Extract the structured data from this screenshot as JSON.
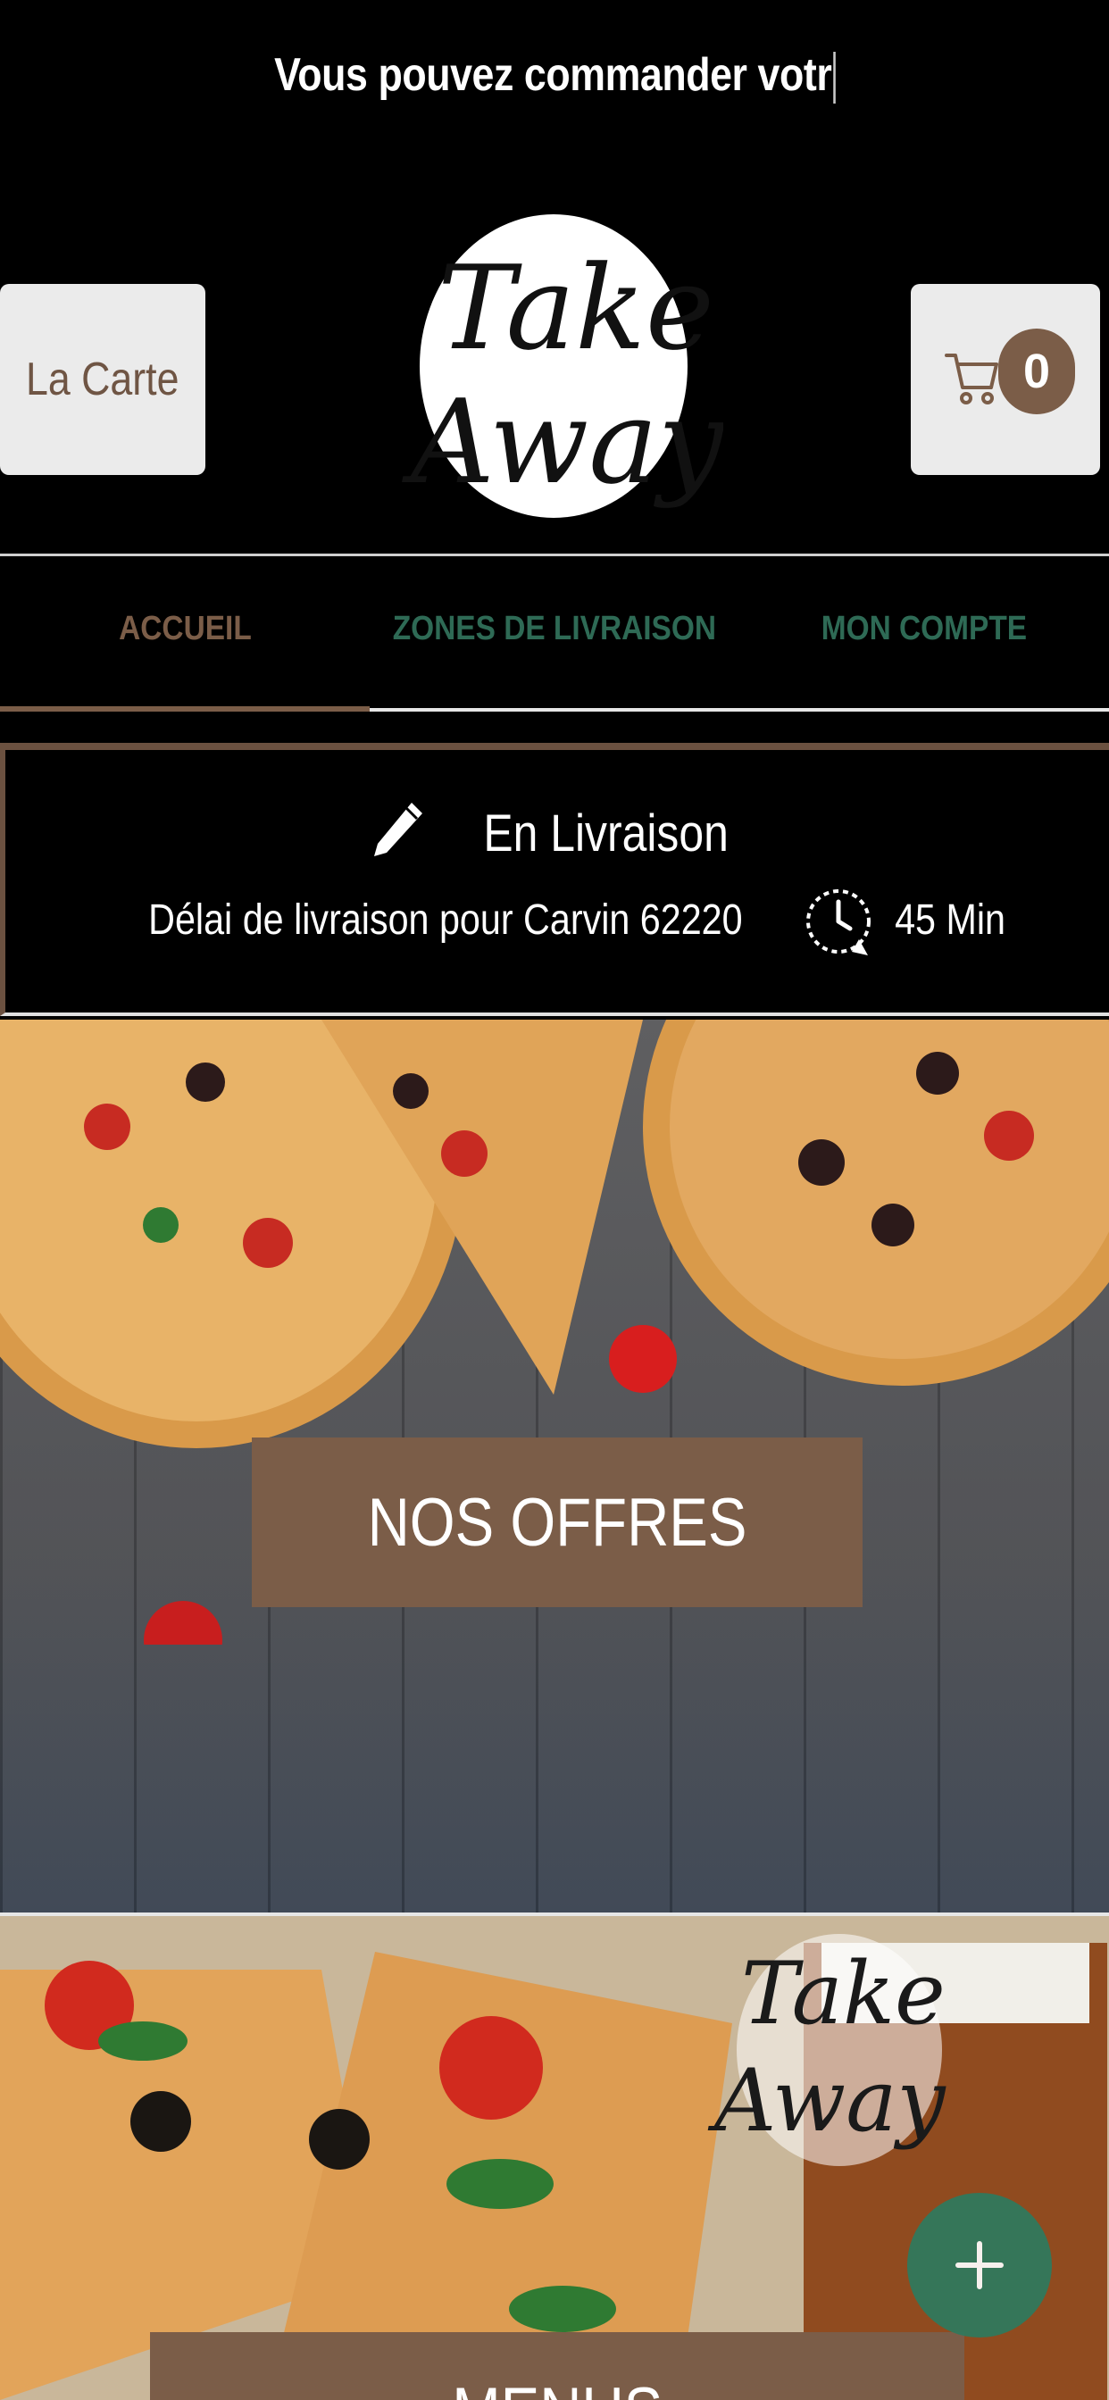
{
  "announcement": {
    "text": "Vous pouvez commander votr"
  },
  "header": {
    "menu_button_label": "La Carte",
    "cart_count": "0",
    "logo_text": "Take Away"
  },
  "tabs": [
    {
      "label": "ACCUEIL",
      "active": true
    },
    {
      "label": "ZONES DE LIVRAISON",
      "active": false
    },
    {
      "label": "MON COMPTE",
      "active": false
    }
  ],
  "delivery": {
    "mode": "En Livraison",
    "delay_text": "Délai de livraison pour Carvin 62220",
    "delay_value": "45 Min",
    "icons": [
      "pencil-icon",
      "clock-icon"
    ]
  },
  "sections": {
    "offers_label": "NOS OFFRES",
    "menus_label": "MENUS"
  },
  "fab": {
    "icon": "plus-icon"
  },
  "colors": {
    "brand_brown": "#7b5d48",
    "tab_green": "#2e6a55",
    "fab_green": "#2e7a5e",
    "background": "#000000"
  }
}
